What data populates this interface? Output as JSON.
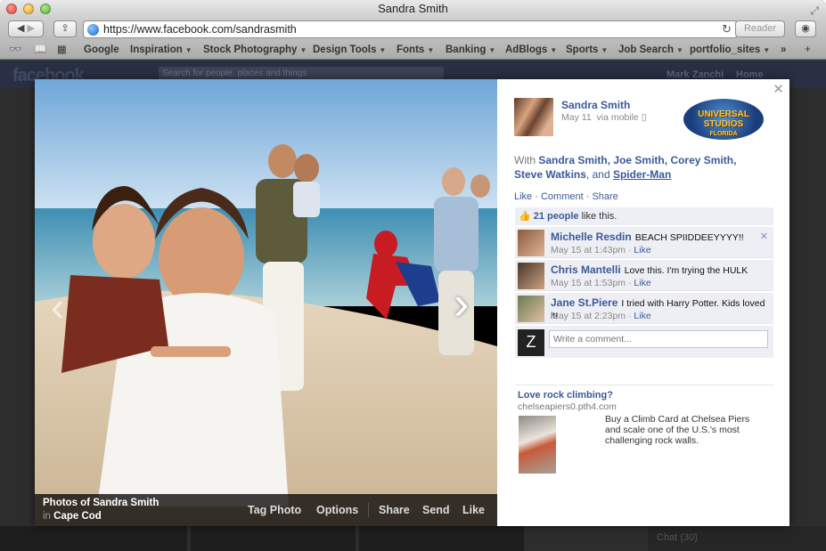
{
  "window": {
    "title": "Sandra Smith"
  },
  "browser": {
    "url": "https://www.facebook.com/sandrasmith",
    "reader_label": "Reader",
    "bookmarks": [
      {
        "label": "Google",
        "menu": false
      },
      {
        "label": "Inspiration",
        "menu": true
      },
      {
        "label": "Stock Photography",
        "menu": true
      },
      {
        "label": "Design Tools",
        "menu": true
      },
      {
        "label": "Fonts",
        "menu": true
      },
      {
        "label": "Banking",
        "menu": true
      },
      {
        "label": "AdBlogs",
        "menu": true
      },
      {
        "label": "Sports",
        "menu": true
      },
      {
        "label": "Job Search",
        "menu": true
      },
      {
        "label": "portfolio_sites",
        "menu": true
      }
    ],
    "overflow": "»"
  },
  "facebook": {
    "logo": "facebook",
    "search_placeholder": "Search for people, places and things",
    "user": "Mark Zanchi",
    "home": "Home"
  },
  "photo": {
    "album_title": "Photos of Sandra Smith",
    "location_prefix": "in",
    "location": "Cape Cod",
    "actions": [
      "Tag Photo",
      "Options",
      "Share",
      "Send",
      "Like"
    ]
  },
  "post": {
    "author": "Sandra Smith",
    "date": "May 11",
    "via": "via mobile",
    "with_prefix": "With",
    "tagged": [
      "Sandra Smith",
      "Joe Smith",
      "Corey Smith",
      "Steve Watkins"
    ],
    "tagged_and": "and",
    "tagged_last": "Spider-Man",
    "actions": {
      "like": "Like",
      "comment": "Comment",
      "share": "Share"
    },
    "likes_count": "21 people",
    "likes_suffix": "like this.",
    "sponsor_logo_lines": [
      "UNIVERSAL STUDIOS",
      "FLORIDA"
    ]
  },
  "comments": [
    {
      "name": "Michelle Resdin",
      "text": "BEACH SPIIDDEEYYYY!!",
      "time": "May 15 at 1:43pm",
      "like": "Like"
    },
    {
      "name": "Chris Mantelli",
      "text": "Love this. I'm trying the HULK",
      "time": "May 15 at 1:53pm",
      "like": "Like"
    },
    {
      "name": "Jane St.Piere",
      "text": "I tried with Harry Potter. Kids loved it!",
      "time": "May 15 at 2:23pm",
      "like": "Like"
    }
  ],
  "comment_input": {
    "placeholder": "Write a comment..."
  },
  "ad": {
    "title": "Love rock climbing?",
    "domain": "chelseapiers0.pth4.com",
    "body": "Buy a Climb Card at Chelsea Piers and scale one of the U.S.'s most challenging rock walls."
  },
  "chat": {
    "label": "Chat (30)"
  },
  "colors": {
    "fb_blue": "#3b5998",
    "comment_bg": "#edeff4"
  }
}
